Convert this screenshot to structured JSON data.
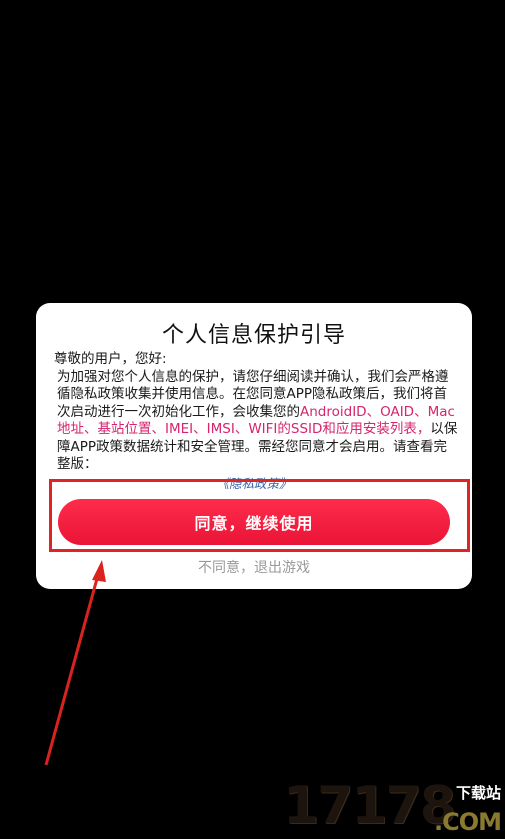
{
  "dialog": {
    "title": "个人信息保护引导",
    "greeting": "尊敬的用户，您好:",
    "para1": "为加强对您个人信息的保护，请您仔细阅读并确认，我们会严格遵循隐私政策收集并使用信息。在您同意APP隐私政策后，我们将首次启动进行一次初始化工作，会收集您的",
    "highlight": "AndroidID、OAID、Mac地址、基站位置、IMEI、IMSI、WIFI的SSID和应用安装列表，",
    "para2": "以保障APP政策数据统计和安全管理。需经您同意才会启用。请查看完整版：",
    "policy_link": "《隐私政策》",
    "agree_button": "同意，继续使用",
    "disagree_link": "不同意，退出游戏"
  },
  "watermark": {
    "digits": "17178",
    "label": "下载站",
    "domain": ".COM"
  },
  "colors": {
    "accent_button": "#ea1436",
    "highlight_text": "#d6246e",
    "annotation_red": "#e02424"
  }
}
